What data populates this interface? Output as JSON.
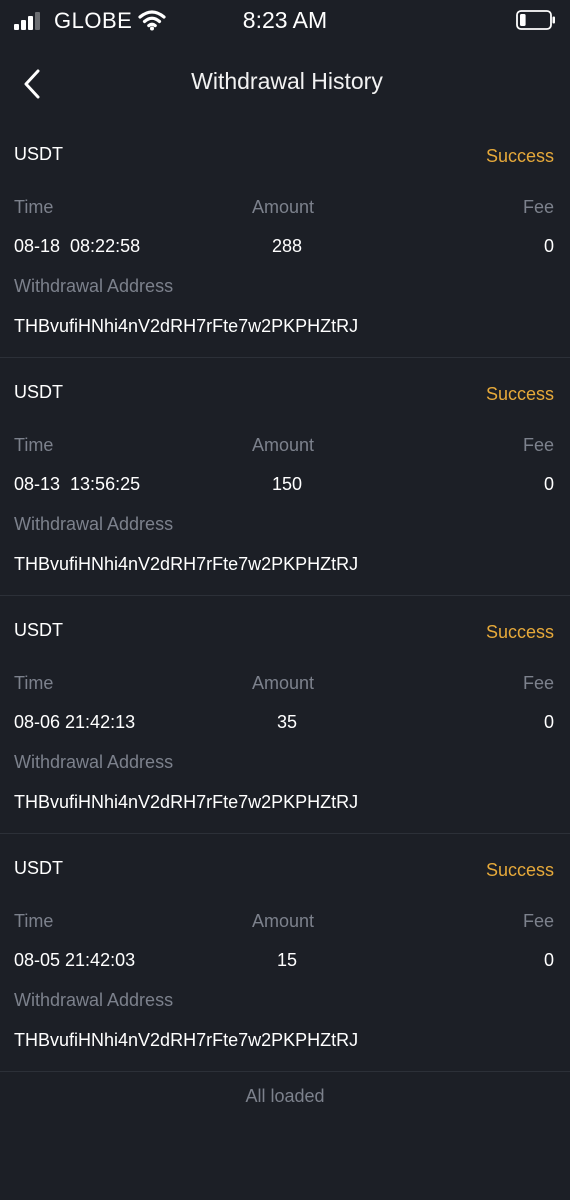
{
  "status_bar": {
    "carrier": "GLOBE",
    "time": "8:23 AM",
    "signal_bars": 3,
    "signal_bars_total": 4,
    "battery_level": 0.2
  },
  "header": {
    "title": "Withdrawal History",
    "back_icon": "chevron-left-icon"
  },
  "labels": {
    "time": "Time",
    "amount": "Amount",
    "fee": "Fee",
    "address": "Withdrawal Address"
  },
  "records": [
    {
      "asset": "USDT",
      "status": "Success",
      "time": "08-18  08:22:58",
      "amount": "288",
      "fee": "0",
      "address": "THBvufiHNhi4nV2dRH7rFte7w2PKPHZtRJ"
    },
    {
      "asset": "USDT",
      "status": "Success",
      "time": "08-13  13:56:25",
      "amount": "150",
      "fee": "0",
      "address": "THBvufiHNhi4nV2dRH7rFte7w2PKPHZtRJ"
    },
    {
      "asset": "USDT",
      "status": "Success",
      "time": "08-06 21:42:13",
      "amount": "35",
      "fee": "0",
      "address": "THBvufiHNhi4nV2dRH7rFte7w2PKPHZtRJ"
    },
    {
      "asset": "USDT",
      "status": "Success",
      "time": "08-05 21:42:03",
      "amount": "15",
      "fee": "0",
      "address": "THBvufiHNhi4nV2dRH7rFte7w2PKPHZtRJ"
    }
  ],
  "footer": {
    "note": "All loaded"
  },
  "colors": {
    "background": "#1c1f26",
    "success": "#e6a93a",
    "label": "#7c818c",
    "divider": "#2c3038"
  }
}
